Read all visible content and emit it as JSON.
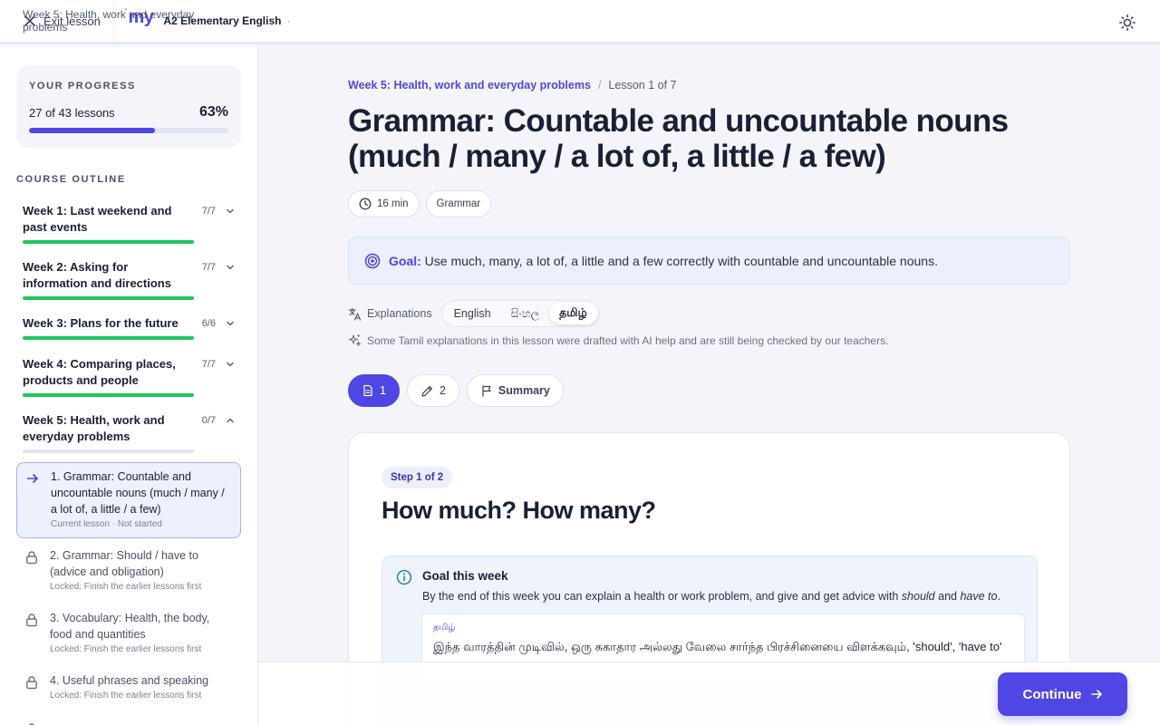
{
  "topbar": {
    "exit_label": "Exit lesson",
    "logo_text": "my",
    "course": "A2 Elementary English",
    "separator": "·",
    "week": "Week 5: Health, work and everyday problems"
  },
  "sidebar": {
    "progress": {
      "label": "YOUR PROGRESS",
      "count": "27 of 43 lessons",
      "percent_text": "63%",
      "fraction": 0.63
    },
    "outline_label": "COURSE OUTLINE",
    "weeks": [
      {
        "title": "Week 1: Last weekend and past events",
        "count": "7/7",
        "complete": true
      },
      {
        "title": "Week 2: Asking for information and directions",
        "count": "7/7",
        "complete": true
      },
      {
        "title": "Week 3: Plans for the future",
        "count": "6/6",
        "complete": true
      },
      {
        "title": "Week 4: Comparing places, products and people",
        "count": "7/7",
        "complete": true
      },
      {
        "title": "Week 5: Health, work and everyday problems",
        "count": "0/7",
        "complete": false
      }
    ],
    "lessons": [
      {
        "title": "1. Grammar: Countable and uncountable nouns (much / many / a lot of, a little / a few)",
        "status": "Current lesson · Not started"
      },
      {
        "title": "2. Grammar: Should / have to (advice and obligation)",
        "status": "Locked: Finish the earlier lessons first"
      },
      {
        "title": "3. Vocabulary: Health, the body, food and quantities",
        "status": "Locked: Finish the earlier lessons first"
      },
      {
        "title": "4. Useful phrases and speaking",
        "status": "Locked: Finish the earlier lessons first"
      }
    ]
  },
  "main": {
    "breadcrumb": {
      "week": "Week 5: Health, work and everyday problems",
      "sep": "/",
      "lesson": "Lesson 1 of 7"
    },
    "title": "Grammar: Countable and uncountable nouns (much / many / a lot of, a little / a few)",
    "chips": {
      "duration": "16 min",
      "type": "Grammar"
    },
    "goal": {
      "label": "Goal:",
      "text": "Use much, many, a lot of, a little and a few correctly with countable and uncountable nouns."
    },
    "explanations": {
      "label": "Explanations",
      "options": [
        "English",
        "සිංහල",
        "தமிழ்"
      ],
      "selected": "தமிழ்"
    },
    "ai_note": "Some Tamil explanations in this lesson were drafted with AI help and are still being checked by our teachers.",
    "step_tabs": {
      "tab1": "1",
      "tab2": "2",
      "summary": "Summary"
    },
    "card": {
      "step_badge": "Step 1 of 2",
      "heading": "How much? How many?",
      "info_title": "Goal this week",
      "info_text_pre": "By the end of this week you can explain a health or work problem, and give and get advice with ",
      "info_em1": "should",
      "info_and": " and ",
      "info_em2": "have to",
      "info_end": ".",
      "tamil_label": "தமிழ்",
      "tamil_text": "இந்த வாரத்தின் முடிவில், ஒரு சுகாதார அல்லது வேலை சார்ந்த பிரச்சினையை விளக்கவும், 'should', 'have to'"
    },
    "continue_label": "Continue"
  },
  "colors": {
    "accent": "#4f46e5",
    "complete": "#22c55e"
  }
}
